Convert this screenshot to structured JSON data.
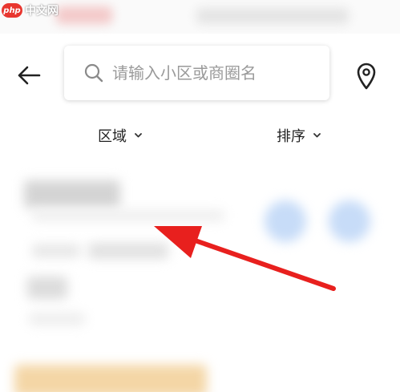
{
  "watermark": {
    "logo": "php",
    "text": "中文网"
  },
  "header": {
    "search": {
      "placeholder": "请输入小区或商圈名",
      "value": ""
    }
  },
  "filters": {
    "region": "区域",
    "sort": "排序"
  },
  "icons": {
    "back": "back-arrow-icon",
    "search": "search-icon",
    "location": "location-pin-icon",
    "chevron": "chevron-down-icon"
  },
  "colors": {
    "annotation_arrow": "#e8201e",
    "placeholder": "#9a9a9a",
    "watermark_red": "#e8362f"
  }
}
